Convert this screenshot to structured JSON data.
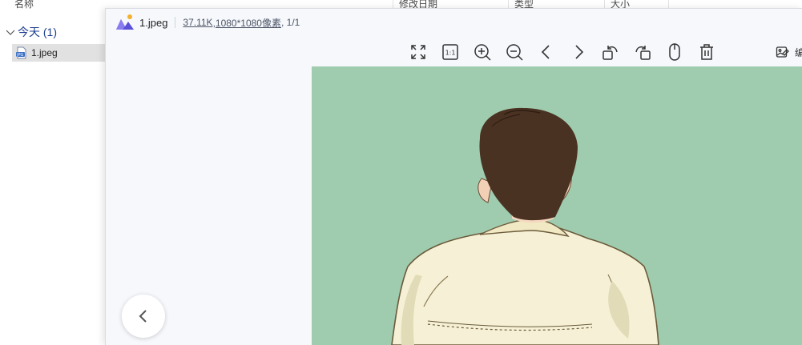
{
  "explorer": {
    "columns": [
      {
        "label": "名称"
      },
      {
        "label": "修改日期"
      },
      {
        "label": "类型"
      },
      {
        "label": "大小"
      }
    ],
    "group": {
      "label": "今天 (1)",
      "icon": "chevron-down-icon"
    },
    "files": [
      {
        "name": "1.jpeg",
        "icon": "jpeg-file-icon",
        "selected": true
      }
    ]
  },
  "viewer": {
    "title": {
      "filename": "1.jpeg",
      "filesize": "37.11K",
      "dimensions": ",1080*1080像素",
      "page": ", 1/1"
    },
    "toolbar": {
      "buttons": [
        {
          "name": "fullscreen-icon"
        },
        {
          "name": "actual-size-icon",
          "label": "1:1"
        },
        {
          "name": "zoom-in-icon"
        },
        {
          "name": "zoom-out-icon"
        },
        {
          "name": "previous-icon"
        },
        {
          "name": "next-icon"
        },
        {
          "name": "rotate-left-icon"
        },
        {
          "name": "rotate-right-icon"
        },
        {
          "name": "mouse-icon"
        },
        {
          "name": "delete-icon"
        }
      ],
      "edit_label": "编"
    },
    "colors": {
      "background": "#f6f8fc",
      "photo_background": "#9fcbae",
      "hair": "#4a3222",
      "shirt": "#f6f1d6",
      "accent": "#1e3d8f"
    }
  }
}
